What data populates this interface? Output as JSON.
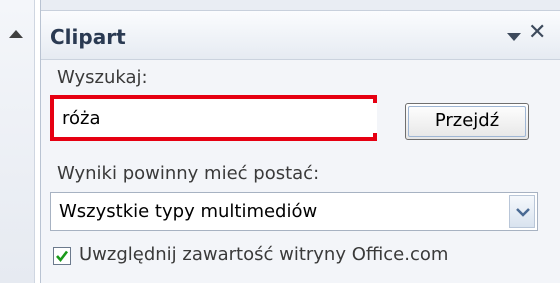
{
  "pane": {
    "title": "Clipart"
  },
  "search": {
    "label": "Wyszukaj:",
    "value": "róża",
    "go_label": "Przejdź"
  },
  "results": {
    "label": "Wyniki powinny mieć postać:",
    "selected": "Wszystkie typy multimediów"
  },
  "office": {
    "checkbox_label": "Uwzględnij zawartość witryny Office.com",
    "checked": true
  },
  "colors": {
    "highlight": "#e60012",
    "check": "#1a9a1a"
  },
  "icons": {
    "collapse": "triangle-up-icon",
    "dropdown": "triangle-down-icon",
    "close": "close-icon",
    "check": "checkmark-icon",
    "select_arrow": "chevron-down-icon"
  }
}
